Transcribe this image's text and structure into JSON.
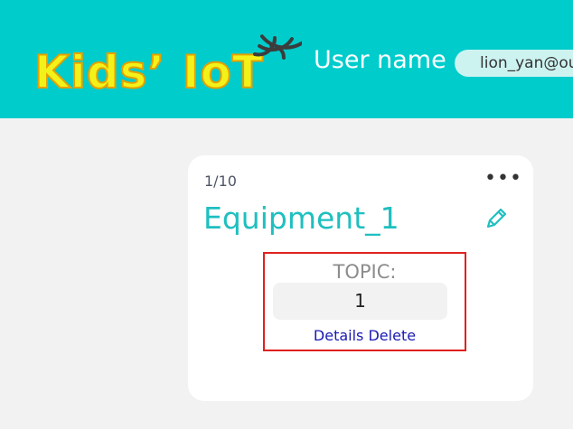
{
  "header": {
    "logo_text": "Kids’ IoT",
    "user_label": "User name",
    "user_value": "lion_yan@outlook.com"
  },
  "card": {
    "count": "1/10",
    "title": "Equipment_1",
    "more_label": "•••",
    "topic_label": "TOPIC:",
    "topic_value": "1",
    "details_label": "Details",
    "delete_label": "Delete"
  },
  "colors": {
    "header_bg": "#00cccc",
    "logo_fill": "#f2f21a",
    "title": "#1fbfbf",
    "link": "#1a1ab3",
    "highlight_border": "#e02020"
  }
}
